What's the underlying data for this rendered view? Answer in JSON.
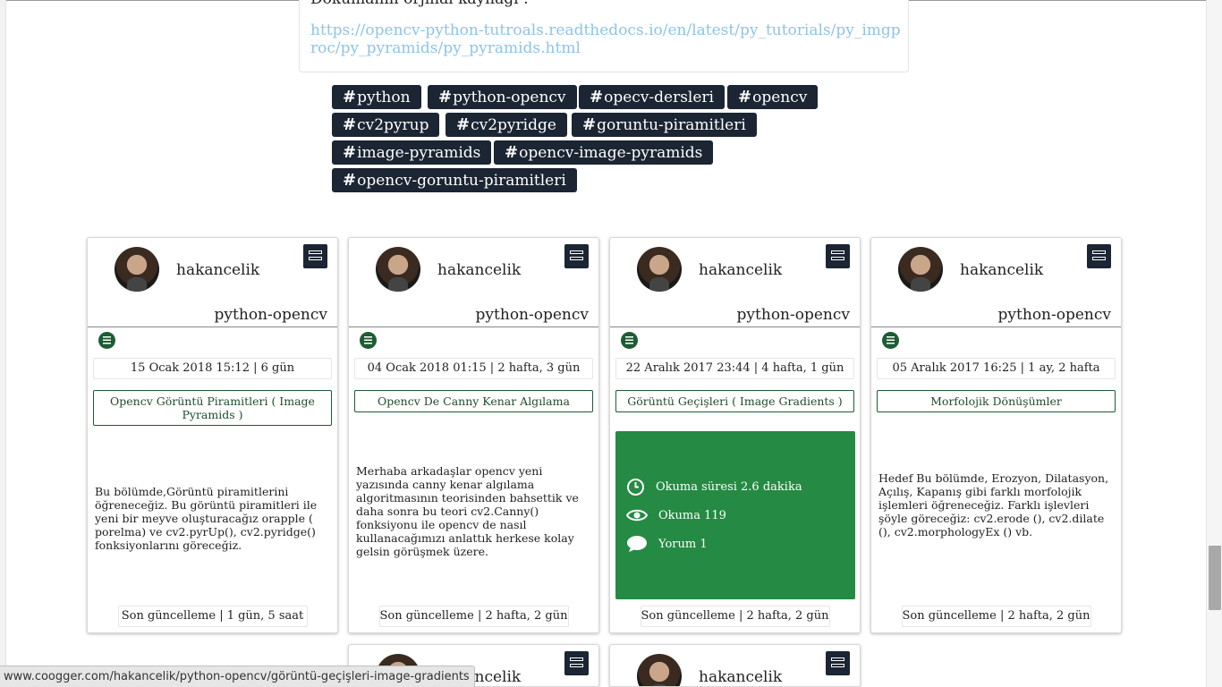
{
  "source": {
    "title": "Dokümanın orjinal kaynağı :",
    "link": "https://opencv-python-tutroals.readthedocs.io/en/latest/py_tutorials/py_imgproc/py_pyramids/py_pyramids.html"
  },
  "tags": [
    "python",
    "python-opencv",
    "opecv-dersleri",
    "opencv",
    "cv2pyrup",
    "cv2pyridge",
    "goruntu-piramitleri",
    "image-pyramids",
    "opencv-image-pyramids",
    "opencv-goruntu-piramitleri"
  ],
  "cards": [
    {
      "username": "hakancelik",
      "category": "python-opencv",
      "date": "15 Ocak 2018 15:12 | 6 gün",
      "title": "Opencv Görüntü Piramitleri ( Image Pyramids )",
      "excerpt": "Bu bölümde,Görüntü piramitlerini öğreneceğiz. Bu görüntü piramitleri ile yeni bir meyve oluşturacağız orapple ( porelma) ve cv2.pyrUp(), cv2.pyridge() fonksiyonlarını göreceğiz.",
      "updated": "Son güncelleme | 1 gün, 5 saat"
    },
    {
      "username": "hakancelik",
      "category": "python-opencv",
      "date": "04 Ocak 2018 01:15 | 2 hafta, 3 gün",
      "title": "Opencv De Canny Kenar Algılama",
      "excerpt": "Merhaba arkadaşlar opencv yeni yazısında canny kenar algılama algoritmasının teorisinden bahsettik ve daha sonra bu teori cv2.Canny() fonksiyonu ile opencv de nasıl kullanacağımızı anlattık herkese kolay gelsin görüşmek üzere.",
      "updated": "Son güncelleme | 2 hafta, 2 gün"
    },
    {
      "username": "hakancelik",
      "category": "python-opencv",
      "date": "22 Aralık 2017 23:44 | 4 hafta, 1 gün",
      "title": "Görüntü Geçişleri ( Image Gradients )",
      "stats": {
        "reading_time": "Okuma süresi 2.6 dakika",
        "views": "Okuma 119",
        "comments": "Yorum 1"
      },
      "updated": "Son güncelleme | 2 hafta, 2 gün"
    },
    {
      "username": "hakancelik",
      "category": "python-opencv",
      "date": "05 Aralık 2017 16:25 | 1 ay, 2 hafta",
      "title": "Morfolojik Dönüşümler",
      "excerpt": "Hedef Bu bölümde, Erozyon, Dilatasyon, Açılış, Kapanış gibi farklı morfolojik işlemleri öğreneceğiz. Farklı işlevleri şöyle göreceğiz: cv2.erode (), cv2.dilate (), cv2.morphologyEx () vb.",
      "updated": "Son güncelleme | 2 hafta, 2 gün"
    },
    {
      "username": "hakancelik"
    },
    {
      "username": "hakancelik"
    }
  ],
  "status_bar": "www.coogger.com/hakancelik/python-opencv/görüntü-geçişleri-image-gradients"
}
